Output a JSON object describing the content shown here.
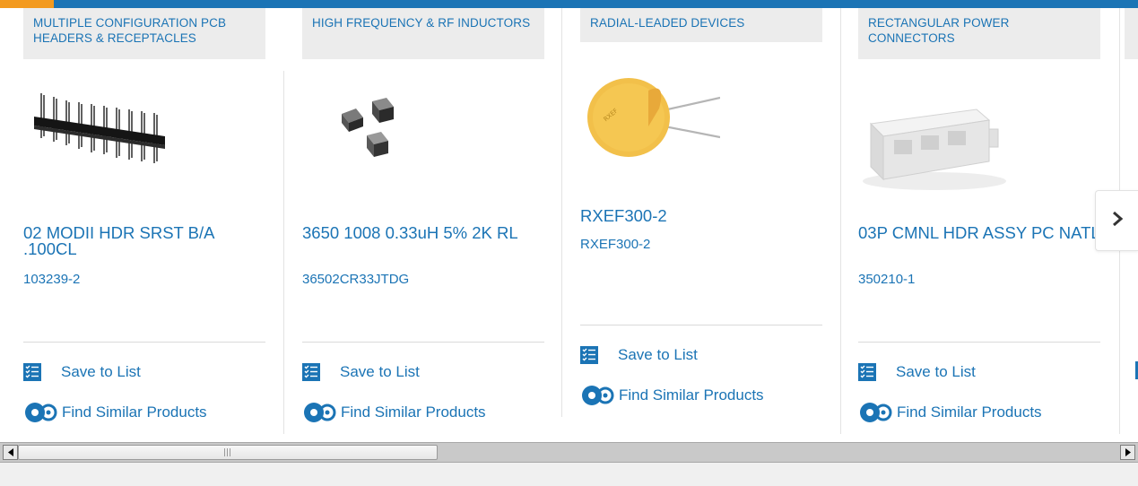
{
  "colors": {
    "brand": "#1b74b5",
    "accent": "#f39a1f",
    "category_bg": "#ececec"
  },
  "products": [
    {
      "category": "MULTIPLE CONFIGURATION PCB HEADERS & RECEPTACLES",
      "name": "02 MODII HDR SRST B/A .100CL",
      "part": "103239-2",
      "image": "pcb-header-pins-image"
    },
    {
      "category": "HIGH FREQUENCY & RF INDUCTORS",
      "name": "3650 1008 0.33uH 5% 2K RL",
      "part": "36502CR33JTDG",
      "image": "rf-inductor-chips-image"
    },
    {
      "category": "RADIAL-LEADED DEVICES",
      "name": "RXEF300-2",
      "part": "RXEF300-2",
      "image": "radial-leaded-fuse-image"
    },
    {
      "category": "RECTANGULAR POWER CONNECTORS",
      "name": "03P CMNL HDR ASSY PC NATL",
      "part": "350210-1",
      "image": "power-connector-image"
    }
  ],
  "actions": {
    "save_label": "Save to List",
    "similar_label": "Find Similar Products"
  },
  "carousel": {
    "next_icon": "chevron-right-icon"
  },
  "scrollbar": {
    "left_icon": "scroll-left-arrow-icon",
    "right_icon": "scroll-right-arrow-icon"
  }
}
